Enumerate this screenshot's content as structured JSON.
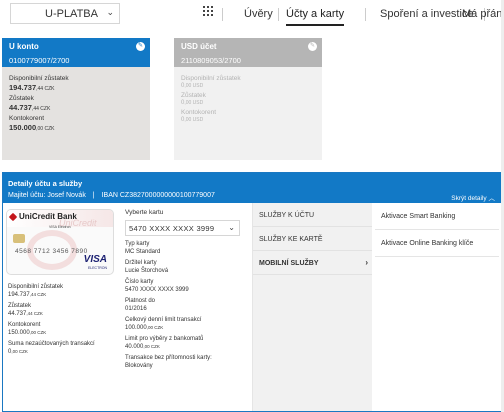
{
  "topnav": {
    "selector_value": "U-PLATBA",
    "items": [
      {
        "label": "Úvěry"
      },
      {
        "label": "Účty a karty"
      },
      {
        "label": "Spoření a investice"
      },
      {
        "label": "Má přání"
      }
    ]
  },
  "accounts": [
    {
      "name": "U konto",
      "number": "0100779007/2700",
      "available_label": "Disponibilní zůstatek",
      "available_value": "194.737",
      "available_suffix": ",44 CZK",
      "balance_label": "Zůstatek",
      "balance_value": "44.737",
      "balance_suffix": ",44 CZK",
      "overdraft_label": "Kontokorent",
      "overdraft_value": "150.000",
      "overdraft_suffix": ",00 CZK"
    },
    {
      "name": "USD účet",
      "number": "2110809053/2700",
      "available_label": "Disponibilní zůstatek",
      "available_value": "0",
      "available_suffix": ",00 USD",
      "balance_label": "Zůstatek",
      "balance_value": "0",
      "balance_suffix": ",00 USD",
      "overdraft_label": "Kontokorent",
      "overdraft_value": "0",
      "overdraft_suffix": ",00 USD"
    }
  ],
  "details": {
    "title": "Detaily účtu a služby",
    "owner_label": "Majitel účtu:",
    "owner_name": "Josef Novák",
    "iban_label": "IBAN",
    "iban": "CZ3827000000000100779007",
    "hide_label": "Skrýt detaily",
    "card_image": {
      "bank": "UniCredit Bank",
      "ghost_text": "UniCredit",
      "mini_text": "VISA Electron",
      "number_partial": "4568 7712 3456 7890",
      "brand": "VISA",
      "brand_sub": "ELECTRON"
    },
    "left_col": [
      {
        "label": "Disponibilní zůstatek",
        "value": "194.737",
        "suffix": ",44 CZK"
      },
      {
        "label": "Zůstatek",
        "value": "44.737",
        "suffix": ",44 CZK"
      },
      {
        "label": "Kontokorent",
        "value": "150.000",
        "suffix": ",00 CZK"
      },
      {
        "label": "Suma nezaúčtovaných transakcí",
        "value": "0",
        "suffix": ",00 CZK"
      }
    ],
    "card_picker": {
      "label": "Vyberte kartu",
      "value": "5470 XXXX XXXX 3999"
    },
    "card_info": [
      {
        "label": "Typ karty",
        "value": "MC Standard"
      },
      {
        "label": "Držitel karty",
        "value": "Lucie Štorchová"
      },
      {
        "label": "Číslo karty",
        "value": "5470 XXXX XXXX 3999"
      },
      {
        "label": "Platnost do",
        "value": "01/2016"
      },
      {
        "label": "Celkový denní limit transakcí",
        "value": "100.000",
        "suffix": ",00 CZK"
      },
      {
        "label": "Limit pro výběry z bankomatů",
        "value": "40.000",
        "suffix": ",00 CZK"
      },
      {
        "label": "Transakce bez přítomnosti karty:",
        "value": "Blokovány"
      }
    ],
    "menu": [
      {
        "label": "SLUŽBY K ÚČTU"
      },
      {
        "label": "SLUŽBY KE KARTĚ"
      },
      {
        "label": "MOBILNÍ SLUŽBY"
      }
    ],
    "links": [
      {
        "label": "Aktivace Smart Banking"
      },
      {
        "label": "Aktivace Online Banking klíče"
      }
    ]
  },
  "colors": {
    "brand_blue": "#1279c6",
    "card_bg": "#e4e2e0",
    "inactive_gray": "#b5b5b5"
  }
}
